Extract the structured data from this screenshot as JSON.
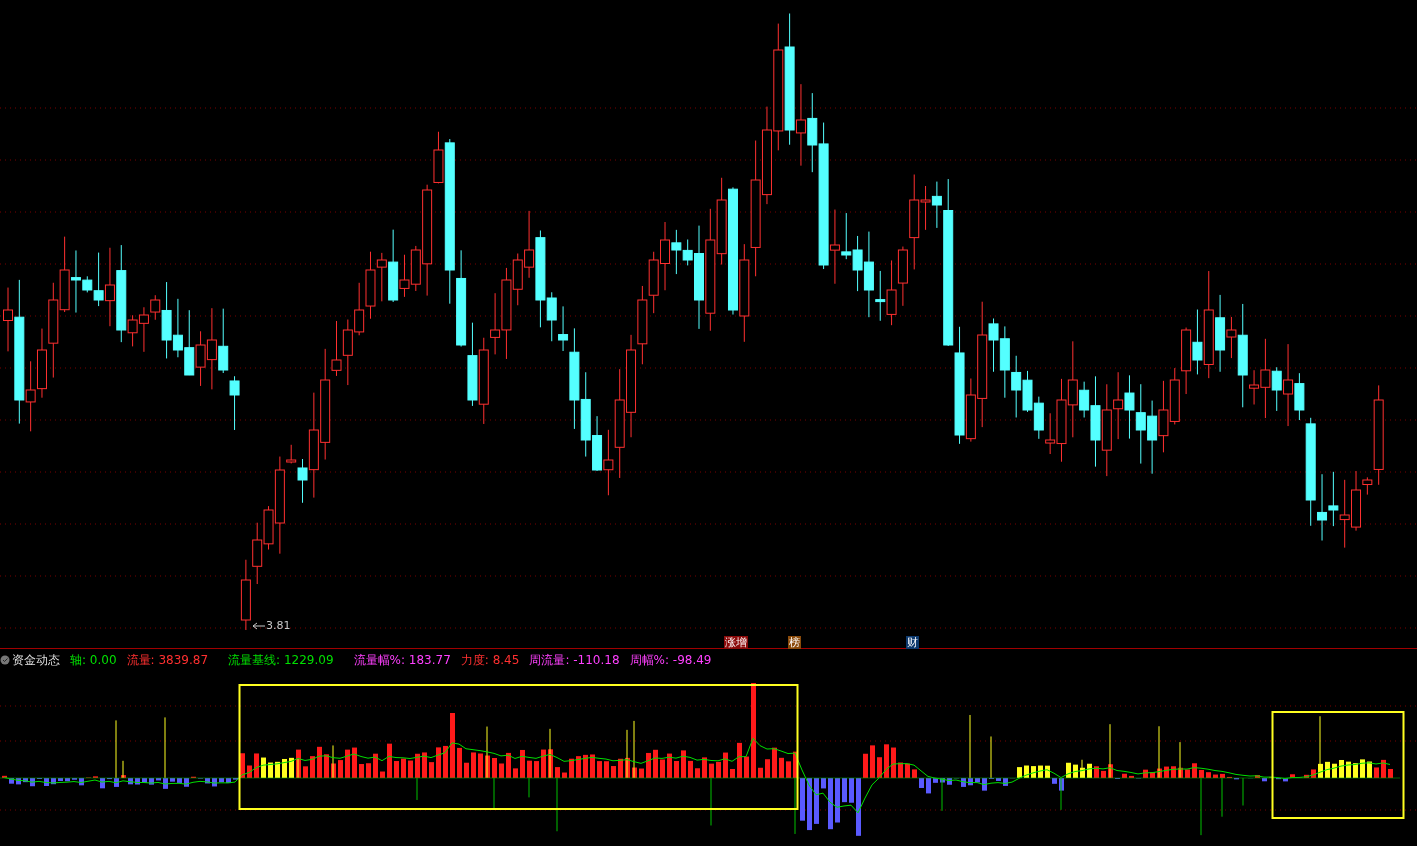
{
  "price_chart": {
    "low_label": "3.81"
  },
  "event_badges": [
    {
      "text": "涨增",
      "color": "#8b0a0a"
    },
    {
      "text": "榜",
      "color": "#8a4a0a"
    },
    {
      "text": "财",
      "color": "#0e3a6e"
    }
  ],
  "indicator": {
    "name": "资金动态",
    "values": [
      {
        "label": "轴:",
        "value": "0.00",
        "color": "#00e000"
      },
      {
        "label": "流量:",
        "value": "3839.87",
        "color": "#ff3030"
      },
      {
        "label": "流量基线:",
        "value": "1229.09",
        "color": "#00e000"
      },
      {
        "label": "流量幅%:",
        "value": "183.77",
        "color": "#ff40ff"
      },
      {
        "label": "力度:",
        "value": "8.45",
        "color": "#ff3030"
      },
      {
        "label": "周流量:",
        "value": "-110.18",
        "color": "#ff40ff"
      },
      {
        "label": "周幅%:",
        "value": "-98.49",
        "color": "#ff40ff"
      }
    ]
  }
}
